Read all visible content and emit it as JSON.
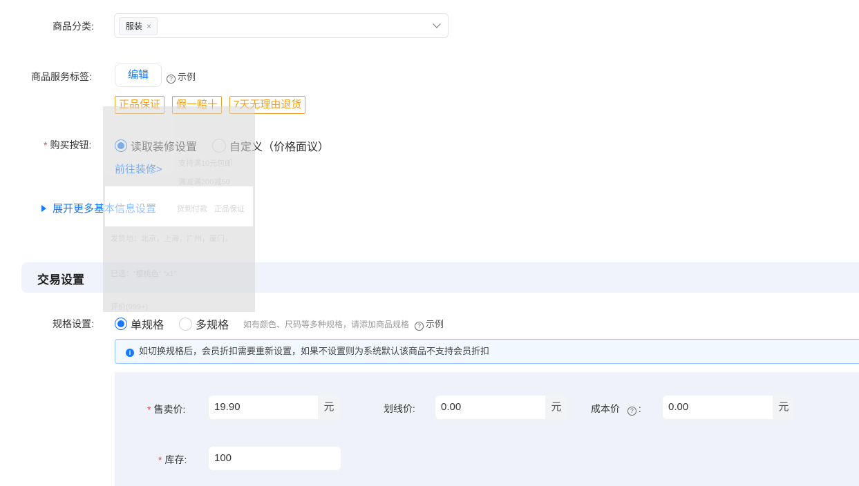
{
  "category": {
    "label": "商品分类:",
    "selected_tag": "服装",
    "remove_glyph": "×"
  },
  "service_tags": {
    "label": "商品服务标签:",
    "edit_label": "编辑",
    "example_label": "示例",
    "help_glyph": "?",
    "tags": [
      "正品保证",
      "假一赔十",
      "7天无理由退货"
    ]
  },
  "buy_button": {
    "required_mark": "*",
    "label": "购买按钮:",
    "options": [
      "读取装修设置",
      "自定义（价格面议）"
    ],
    "selected_index": 0,
    "link_label": "前往装修>"
  },
  "expand_more": {
    "label": "展开更多基本信息设置"
  },
  "trade_section": {
    "title": "交易设置"
  },
  "spec": {
    "label": "规格设置:",
    "options": [
      "单规格",
      "多规格"
    ],
    "selected_index": 0,
    "hint": "如有颜色、尺码等多种规格，请添加商品规格",
    "example_label": "示例",
    "help_glyph": "?"
  },
  "info_banner": {
    "icon": "info-icon",
    "icon_glyph": "i",
    "text": "如切换规格后，会员折扣需要重新设置，如果不设置则为系统默认该商品不支持会员折扣"
  },
  "pricing": {
    "required_mark": "*",
    "sale_price_label": "售卖价:",
    "sale_price_value": "19.90",
    "strike_price_label": "划线价:",
    "strike_price_value": "0.00",
    "cost_price_label": "成本价",
    "cost_price_colon": ":",
    "cost_price_value": "0.00",
    "help_glyph": "?",
    "unit": "元",
    "stock_label": "库存:",
    "stock_value": "100"
  },
  "ghost_preview": {
    "lines": [
      "支持满10元包邮",
      "满减满200减50",
      "货到付款",
      "正品保证",
      "发货地：北京，上海，广州，厦门，",
      "已选：“樱桃色” “x1”",
      "评价(999+)"
    ]
  },
  "colors": {
    "accent": "#1677ff",
    "tag_orange": "#f0a020",
    "required": "#e5484d",
    "section_bg": "#f0f3fc",
    "panel_bg": "#eff2f9"
  }
}
